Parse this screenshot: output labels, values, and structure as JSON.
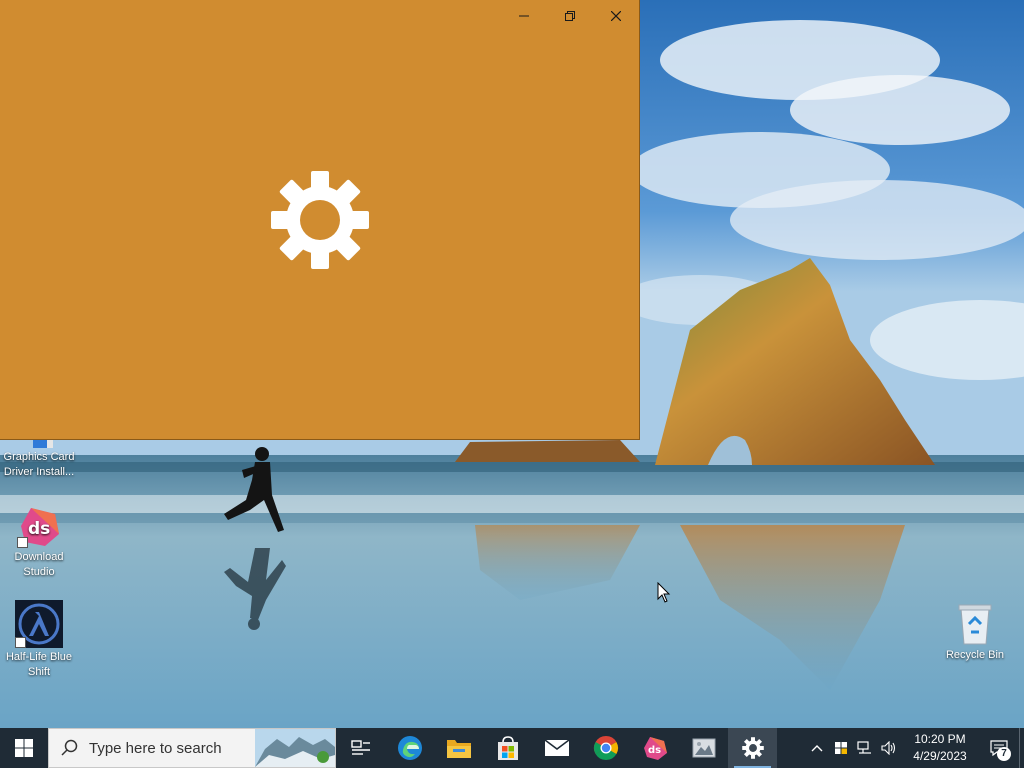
{
  "window": {
    "background": "#d08c30",
    "app_icon": "gear-icon",
    "controls": [
      "minimize",
      "restore",
      "close"
    ]
  },
  "desktop_icons": [
    {
      "label": "Graphics Card Driver Install...",
      "icon": "graphics-driver-icon"
    },
    {
      "label": "Download Studio",
      "icon": "download-studio-icon"
    },
    {
      "label": "Half-Life Blue Shift",
      "icon": "half-life-icon"
    },
    {
      "label": "Recycle Bin",
      "icon": "recycle-bin-icon"
    }
  ],
  "taskbar": {
    "search_placeholder": "Type here to search",
    "pinned": [
      "task-view",
      "edge",
      "file-explorer",
      "microsoft-store",
      "mail",
      "chrome",
      "download-studio",
      "photos",
      "settings"
    ],
    "active": "settings",
    "clock": {
      "time": "10:20 PM",
      "date": "4/29/2023"
    },
    "notification_count": "7",
    "background": "#1f2b36"
  }
}
